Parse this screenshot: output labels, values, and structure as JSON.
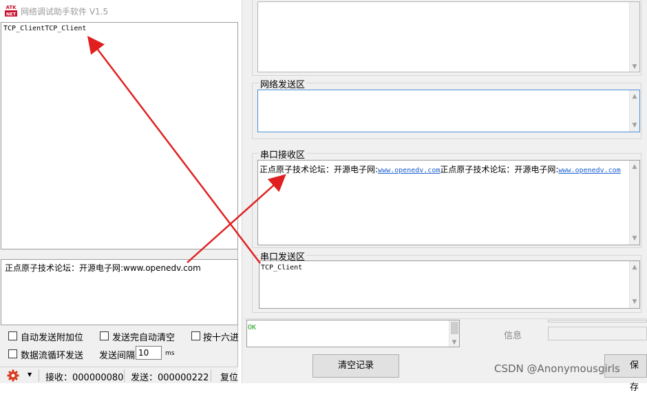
{
  "left_window": {
    "title": "网络调试助手软件 V1.5",
    "logo_top": "ATK",
    "logo_bottom": "NET",
    "receive_text": "TCP_ClientTCP_Client",
    "send_text": "正点原子技术论坛：开源电子网:www.openedv.com",
    "options": {
      "auto_append": "自动发送附加位",
      "auto_clear": "发送完自动清空",
      "hex_send": "按十六进",
      "loop_send": "数据流循环发送",
      "interval_label": "发送间隔",
      "interval_value": "10",
      "interval_unit": "ms"
    },
    "status": {
      "received": "接收：000000080",
      "sent": "发送：000000222",
      "reset": "复位"
    }
  },
  "right_window": {
    "net_send_label": "网络发送区",
    "serial_recv_label": "串口接收区",
    "serial_recv_text_1": "正点原子技术论坛：开源电子网:",
    "serial_recv_link_1": "www.openedv.com",
    "serial_recv_text_2": "正点原子技术论坛：开源电子网:",
    "serial_recv_link_2": "www.openedv.com",
    "serial_send_label": "串口发送区",
    "serial_send_text": "TCP_Client",
    "log_text": "OK",
    "info_label": "信息",
    "clear_button": "清空记录",
    "save_button": "保存"
  },
  "watermark": "CSDN @Anonymousgirls",
  "colors": {
    "arrow": "#e02020",
    "link": "#1a5fd1",
    "ok": "#1c9c1c",
    "title_gray": "#9a9a9a",
    "status_icon": "#d93a1e"
  },
  "icons": [
    "atk-logo-icon",
    "gear-icon",
    "dropdown-arrow-icon",
    "scroll-up-icon",
    "scroll-down-icon"
  ]
}
